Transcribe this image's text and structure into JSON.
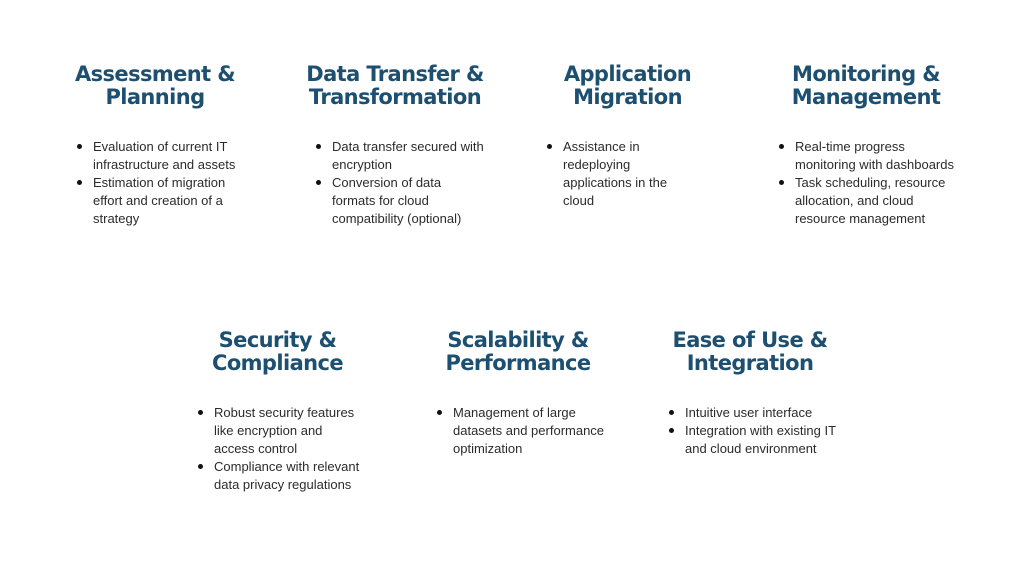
{
  "sections": [
    {
      "title_line1": "Assessment &",
      "title_line2": "Planning",
      "bullets": [
        "Evaluation of current IT infrastructure and assets",
        "Estimation of migration effort and creation of a strategy"
      ]
    },
    {
      "title_line1": "Data Transfer &",
      "title_line2": "Transformation",
      "bullets": [
        "Data transfer secured with encryption",
        "Conversion of data formats for cloud compatibility (optional)"
      ]
    },
    {
      "title_line1": "Application",
      "title_line2": "Migration",
      "bullets": [
        "Assistance in redeploying applications in the cloud"
      ]
    },
    {
      "title_line1": "Monitoring &",
      "title_line2": "Management",
      "bullets": [
        "Real-time progress monitoring with dashboards",
        "Task scheduling, resource allocation, and cloud resource management"
      ]
    },
    {
      "title_line1": "Security &",
      "title_line2": "Compliance",
      "bullets": [
        "Robust security features like encryption and access control",
        "Compliance with relevant data privacy regulations"
      ]
    },
    {
      "title_line1": "Scalability &",
      "title_line2": "Performance",
      "bullets": [
        "Management of large datasets and performance optimization"
      ]
    },
    {
      "title_line1": "Ease of Use &",
      "title_line2": "Integration",
      "bullets": [
        "Intuitive user interface",
        "Integration with existing IT and cloud environment"
      ]
    }
  ]
}
